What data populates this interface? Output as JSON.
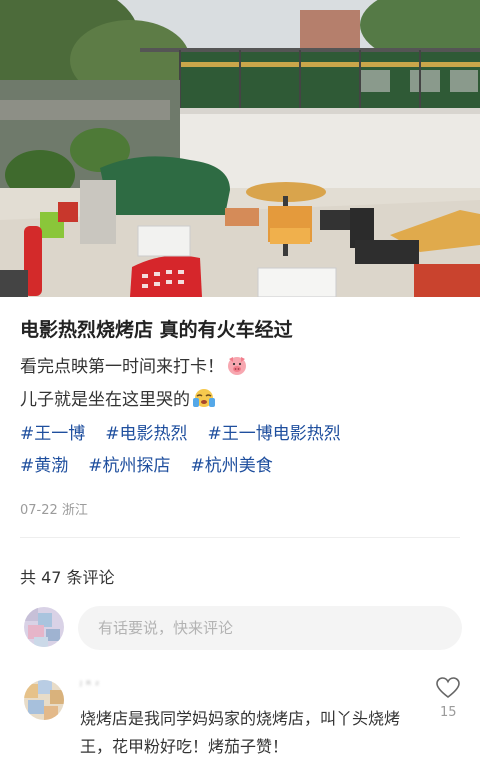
{
  "post": {
    "title": "电影热烈烧烤店 真的有火车经过",
    "line1": "看完点映第一时间来打卡！",
    "line2": "儿子就是坐在这里哭的",
    "tags_row1": [
      "#王一博",
      "#电影热烈",
      "#王一博电影热烈"
    ],
    "tags_row2": [
      "#黄渤",
      "#杭州探店",
      "#杭州美食"
    ],
    "meta": "07-22 浙江"
  },
  "comments": {
    "count_label": "共 47 条评论",
    "input_placeholder": "有话要说，快来评论",
    "items": [
      {
        "username": "ᴶ ᴿ ᶻ",
        "text": "烧烤店是我同学妈妈家的烧烤店，叫丫头烧烤王，花甲粉好吃！烤茄子赞！",
        "likes": "15"
      }
    ]
  },
  "icons": {
    "emoji1": "pig-face-emoji",
    "emoji2": "crying-face-emoji",
    "like": "heart-icon"
  },
  "colors": {
    "tag": "#1f4f9e",
    "meta": "#9b9b9b"
  }
}
